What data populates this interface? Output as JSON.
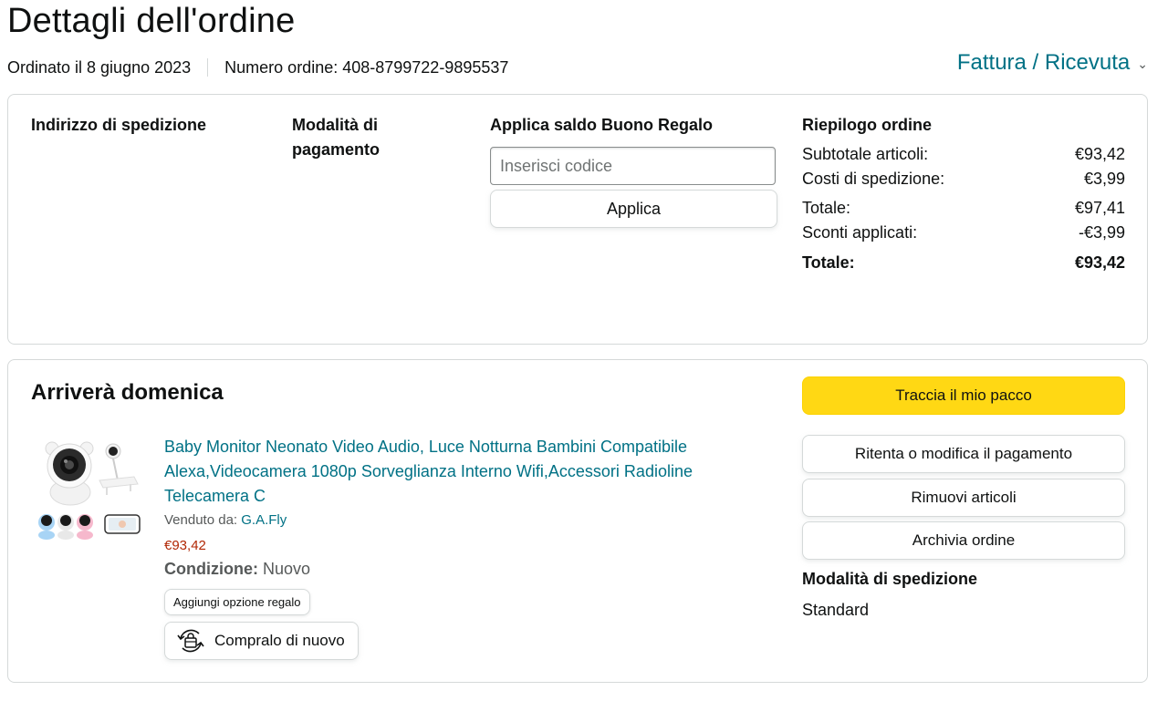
{
  "page": {
    "title": "Dettagli dell'ordine",
    "ordered_on": "Ordinato il 8 giugno 2023",
    "order_number": "Numero ordine: 408-8799722-9895537",
    "invoice_link": "Fattura / Ricevuta"
  },
  "details": {
    "shipping_address_heading": "Indirizzo di spedizione",
    "payment_method_heading_line1": "Modalità di",
    "payment_method_heading_line2": "pagamento",
    "gift_balance_heading": "Applica saldo Buono Regalo",
    "gift_code_placeholder": "Inserisci codice",
    "apply_button": "Applica",
    "summary_heading": "Riepilogo ordine",
    "summary": {
      "items_subtotal_label": "Subtotale articoli:",
      "items_subtotal_value": "€93,42",
      "shipping_label": "Costi di spedizione:",
      "shipping_value": "€3,99",
      "total_label": "Totale:",
      "total_value": "€97,41",
      "discounts_label": "Sconti applicati:",
      "discounts_value": "-€3,99",
      "grand_total_label": "Totale:",
      "grand_total_value": "€93,42"
    }
  },
  "shipment": {
    "arrival": "Arriverà domenica",
    "product_title": "Baby Monitor Neonato Video Audio, Luce Notturna Bambini Compatibile Alexa,Videocamera 1080p Sorveglianza Interno Wifi,Accessori Radioline Telecamera C",
    "sold_by_label": "Venduto da: ",
    "seller": "G.A.Fly",
    "price": "€93,42",
    "condition_label": "Condizione:",
    "condition_value": " Nuovo",
    "gift_option_button": "Aggiungi opzione regalo",
    "buy_again_button": "Compralo di nuovo",
    "track_button": "Traccia il mio pacco",
    "retry_payment_button": "Ritenta o modifica il pagamento",
    "remove_items_button": "Rimuovi articoli",
    "archive_button": "Archivia ordine",
    "shipping_method_heading": "Modalità di spedizione",
    "shipping_method_value": "Standard"
  },
  "colors": {
    "link": "#007185",
    "price": "#b12704",
    "primary_button": "#ffd814",
    "border": "#d5d9d9"
  },
  "icons": [
    "chevron-down-icon",
    "buy-again-icon",
    "product-image"
  ]
}
